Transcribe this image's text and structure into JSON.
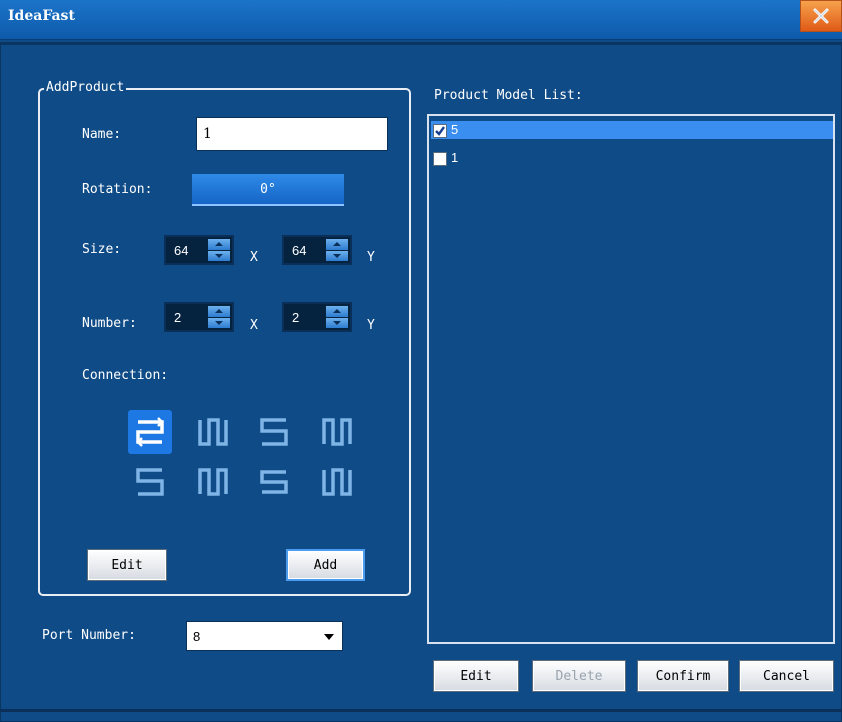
{
  "window": {
    "title": "IdeaFast"
  },
  "add_product": {
    "group_title": "AddProduct",
    "name_label": "Name:",
    "name_value": "1",
    "rotation_label": "Rotation:",
    "rotation_value": "0°",
    "size_label": "Size:",
    "size_x": "64",
    "size_y": "64",
    "number_label": "Number:",
    "number_x": "2",
    "number_y": "2",
    "x_label": "X",
    "y_label": "Y",
    "connection_label": "Connection:",
    "connection_selected": "pattern-1",
    "edit_label": "Edit",
    "add_label": "Add"
  },
  "port": {
    "label": "Port Number:",
    "value": "8"
  },
  "model_list": {
    "title": "Product Model List:",
    "items": [
      {
        "label": "5",
        "checked": true,
        "selected": true
      },
      {
        "label": "1",
        "checked": false,
        "selected": false
      }
    ]
  },
  "actions": {
    "edit": "Edit",
    "delete": "Delete",
    "confirm": "Confirm",
    "cancel": "Cancel"
  },
  "colors": {
    "background": "#0f4b86",
    "accent": "#3a8ef0",
    "close": "#e05a17"
  }
}
